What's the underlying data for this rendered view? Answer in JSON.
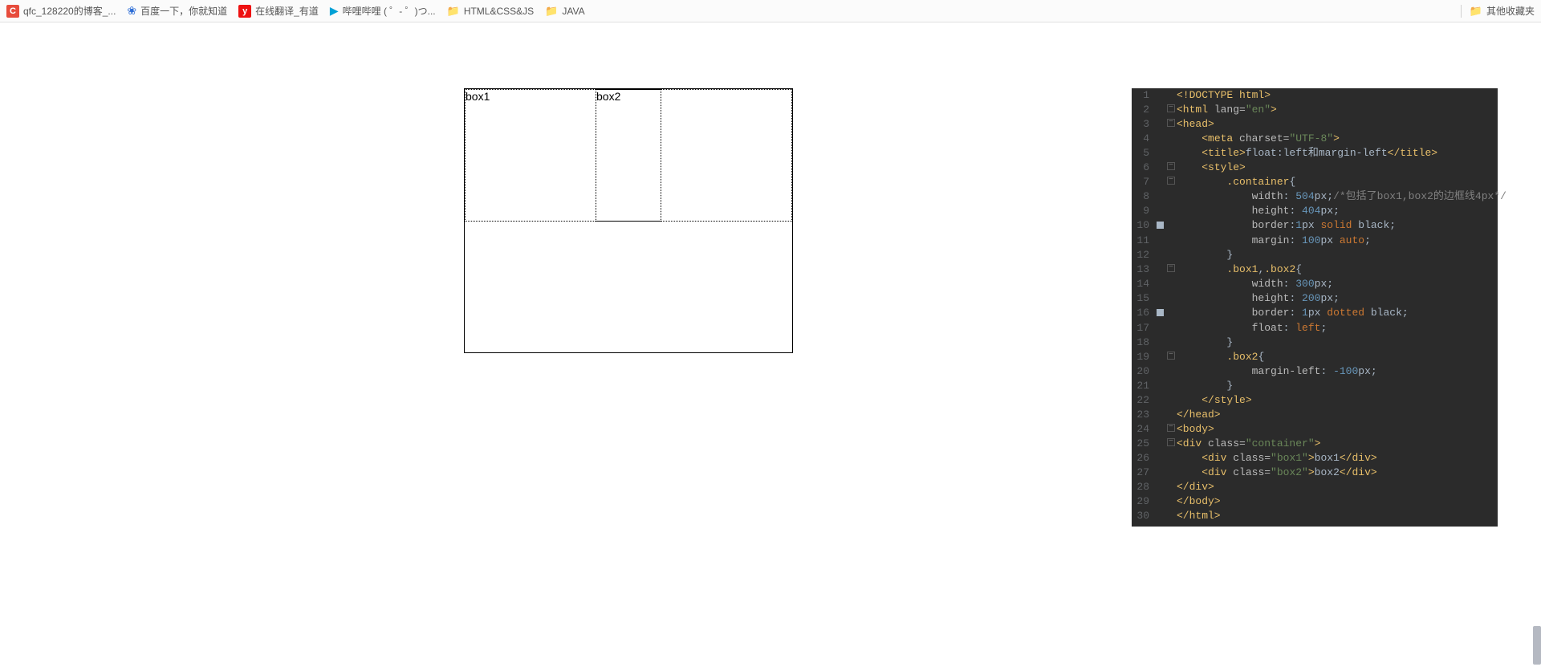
{
  "bookmarks": {
    "left": [
      {
        "icon": "c",
        "label": "qfc_128220的博客_..."
      },
      {
        "icon": "paw",
        "label": "百度一下，你就知道"
      },
      {
        "icon": "y",
        "label": "在线翻译_有道"
      },
      {
        "icon": "bili",
        "label": "哔哩哔哩 ( ゜- ゜)つ..."
      },
      {
        "icon": "folder",
        "label": "HTML&CSS&JS"
      },
      {
        "icon": "folder",
        "label": "JAVA"
      }
    ],
    "right": {
      "icon": "folder",
      "label": "其他收藏夹"
    }
  },
  "demo": {
    "box1": "box1",
    "box2": "box2"
  },
  "code": {
    "lines": [
      {
        "n": "1",
        "html": "<span class='doctype'>&lt;!DOCTYPE html&gt;</span>"
      },
      {
        "n": "2",
        "fold": true,
        "html": "<span class='tag'>&lt;html </span><span class='attr-name'>lang=</span><span class='attr-val'>\"en\"</span><span class='tag'>&gt;</span>"
      },
      {
        "n": "3",
        "fold": true,
        "html": "<span class='tag'>&lt;head&gt;</span>"
      },
      {
        "n": "4",
        "html": "    <span class='tag'>&lt;meta </span><span class='attr-name'>charset=</span><span class='attr-val'>\"UTF-8\"</span><span class='tag'>&gt;</span>"
      },
      {
        "n": "5",
        "html": "    <span class='tag'>&lt;title&gt;</span><span class='txt'>float:left和margin-left</span><span class='tag'>&lt;/title&gt;</span>"
      },
      {
        "n": "6",
        "fold": true,
        "html": "    <span class='tag'>&lt;style&gt;</span>"
      },
      {
        "n": "7",
        "fold": true,
        "html": "        <span class='sel'>.container</span><span class='punct'>{</span>"
      },
      {
        "n": "8",
        "html": "            <span class='prop'>width</span><span class='punct'>: </span><span class='num'>504</span><span class='val'>px</span><span class='punct'>;</span><span class='comment'>/*包括了box1,box2的边框线4px*/</span>"
      },
      {
        "n": "9",
        "html": "            <span class='prop'>height</span><span class='punct'>: </span><span class='num'>404</span><span class='val'>px</span><span class='punct'>;</span>"
      },
      {
        "n": "10",
        "mark": true,
        "html": "            <span class='prop'>border</span><span class='punct'>:</span><span class='num'>1</span><span class='val'>px </span><span class='kw-val'>solid </span><span class='val'>black</span><span class='punct'>;</span>"
      },
      {
        "n": "11",
        "html": "            <span class='prop'>margin</span><span class='punct'>: </span><span class='num'>100</span><span class='val'>px </span><span class='kw-val'>auto</span><span class='punct'>;</span>"
      },
      {
        "n": "12",
        "html": "        <span class='punct'>}</span>"
      },
      {
        "n": "13",
        "fold": true,
        "html": "        <span class='sel'>.box1</span><span class='punct'>,</span><span class='sel'>.box2</span><span class='punct'>{</span>"
      },
      {
        "n": "14",
        "html": "            <span class='prop'>width</span><span class='punct'>: </span><span class='num'>300</span><span class='val'>px</span><span class='punct'>;</span>"
      },
      {
        "n": "15",
        "html": "            <span class='prop'>height</span><span class='punct'>: </span><span class='num'>200</span><span class='val'>px</span><span class='punct'>;</span>"
      },
      {
        "n": "16",
        "mark": true,
        "html": "            <span class='prop'>border</span><span class='punct'>: </span><span class='num'>1</span><span class='val'>px </span><span class='kw-val'>dotted </span><span class='val'>black</span><span class='punct'>;</span>"
      },
      {
        "n": "17",
        "html": "            <span class='prop'>float</span><span class='punct'>: </span><span class='kw-val'>left</span><span class='punct'>;</span>"
      },
      {
        "n": "18",
        "html": "        <span class='punct'>}</span>"
      },
      {
        "n": "19",
        "fold": true,
        "html": "        <span class='sel'>.box2</span><span class='punct'>{</span>"
      },
      {
        "n": "20",
        "html": "            <span class='prop'>margin-left</span><span class='punct'>: </span><span class='num'>-100</span><span class='val'>px</span><span class='punct'>;</span>"
      },
      {
        "n": "21",
        "html": "        <span class='punct'>}</span>"
      },
      {
        "n": "22",
        "html": "    <span class='tag'>&lt;/style&gt;</span>"
      },
      {
        "n": "23",
        "html": "<span class='tag'>&lt;/head&gt;</span>"
      },
      {
        "n": "24",
        "fold": true,
        "html": "<span class='tag'>&lt;body&gt;</span>"
      },
      {
        "n": "25",
        "fold": true,
        "html": "<span class='tag'>&lt;div </span><span class='attr-name'>class=</span><span class='attr-val'>\"container\"</span><span class='tag'>&gt;</span>"
      },
      {
        "n": "26",
        "html": "    <span class='tag'>&lt;div </span><span class='attr-name'>class=</span><span class='attr-val'>\"box1\"</span><span class='tag'>&gt;</span><span class='txt'>box1</span><span class='tag'>&lt;/div&gt;</span>"
      },
      {
        "n": "27",
        "html": "    <span class='tag'>&lt;div </span><span class='attr-name'>class=</span><span class='attr-val'>\"box2\"</span><span class='tag'>&gt;</span><span class='txt'>box2</span><span class='tag'>&lt;/div&gt;</span>"
      },
      {
        "n": "28",
        "html": "<span class='tag'>&lt;/div&gt;</span>"
      },
      {
        "n": "29",
        "html": "<span class='tag'>&lt;/body&gt;</span>"
      },
      {
        "n": "30",
        "html": "<span class='tag'>&lt;/html&gt;</span>"
      }
    ]
  }
}
